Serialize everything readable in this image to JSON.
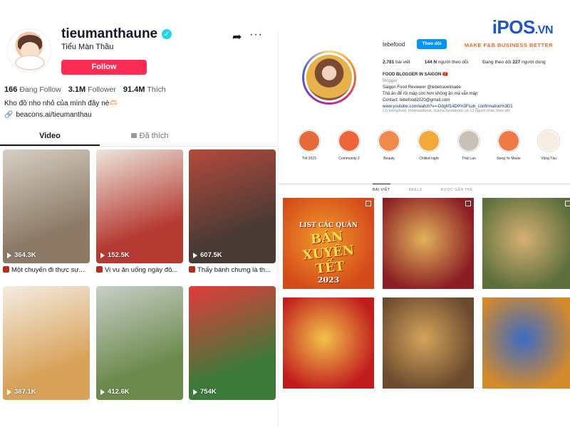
{
  "watermark": {
    "brand": "iPOS",
    "suffix": ".VN",
    "tagline": "MAKE F&B BUSINESS BETTER"
  },
  "tiktok": {
    "username": "tieumanthaune",
    "nickname": "Tiểu Màn Thầu",
    "follow_label": "Follow",
    "stats": {
      "following_count": "166",
      "following_label": "Đang Follow",
      "followers_count": "3.1M",
      "followers_label": "Follower",
      "likes_count": "91.4M",
      "likes_label": "Thích"
    },
    "bio": "Kho đồ nho nhỏ của mình đây nè🫶🏻",
    "link": "beacons.ai/tieumanthau",
    "tabs": [
      {
        "label": "Video"
      },
      {
        "label": "Đã thích"
      }
    ],
    "videos": [
      {
        "views": "364.3K",
        "caption": "Một chuyến đi thực sự...",
        "colors": [
          "#8c7a66",
          "#d7cfc4"
        ]
      },
      {
        "views": "152.5K",
        "caption": "Vi vu ăn uống ngày đô...",
        "colors": [
          "#b53a32",
          "#ece6dc"
        ]
      },
      {
        "views": "607.5K",
        "caption": "Thấy bánh chưng là th...",
        "colors": [
          "#4a3a34",
          "#b44a3c"
        ]
      },
      {
        "views": "387.1K",
        "caption": "",
        "colors": [
          "#d9a25a",
          "#f3ede2"
        ]
      },
      {
        "views": "412.6K",
        "caption": "",
        "colors": [
          "#6c8a4c",
          "#c8cec8"
        ]
      },
      {
        "views": "754K",
        "caption": "",
        "colors": [
          "#3d7a3a",
          "#e23b3b"
        ]
      }
    ]
  },
  "instagram": {
    "username": "tebefood",
    "follow_label": "Theo dõi",
    "stats": {
      "posts_count": "2.781",
      "posts_label": "bài viết",
      "followers_count": "144 N",
      "followers_label": "người theo dõi",
      "following_prefix": "Đang theo dõi",
      "following_count": "227",
      "following_label": "người dùng"
    },
    "bio": {
      "line1": "FOOD BLOGGER IN SAIGON 🇻🇳",
      "line2": "Blogger",
      "line3": "Saigon Food Reviewer @tebetravelmade",
      "line4": "Thả ăn để rồi mập còn hơn không ăn mà vẫn mập",
      "line5": "Contact: tebefood2020@gmail.com",
      "line6": "www.youtube.com/watch?v=-Ddghf14D0%3Fsub_confirmation%3D1"
    },
    "followed_by": "Có fuongfood, linhmeatbook, hukha.foodaholic và 12 người khác theo dõi",
    "highlights": [
      {
        "label": "Tết 2023",
        "color": "#e86a3c"
      },
      {
        "label": "Community 2",
        "color": "#f0643b"
      },
      {
        "label": "Beauty",
        "color": "#f08a4a"
      },
      {
        "label": "Chilled night",
        "color": "#f2a93a"
      },
      {
        "label": "Thái Lan",
        "color": "#c9c1b5"
      },
      {
        "label": "Song Ye Movie",
        "color": "#ef7a45"
      },
      {
        "label": "Vũng Tàu",
        "color": "#f6ece0"
      }
    ],
    "tabs": [
      {
        "label": "BÀI VIẾT"
      },
      {
        "label": "REELS"
      },
      {
        "label": "ĐƯỢC GẮN THẺ"
      }
    ],
    "posts": [
      {
        "colors": [
          "#d44a1a",
          "#f29b2c"
        ],
        "overlay_l1": "LIST CÁC QUÁN",
        "overlay_l2": "BÁN XUYÊN TẾT",
        "overlay_l3": "2023"
      },
      {
        "colors": [
          "#8b1d24",
          "#e2b25a"
        ]
      },
      {
        "colors": [
          "#5b6e3c",
          "#d6b072"
        ]
      },
      {
        "colors": [
          "#c21d1d",
          "#f2c24a"
        ]
      },
      {
        "colors": [
          "#6b4a2e",
          "#d4a35c"
        ]
      },
      {
        "colors": [
          "#d58a2a",
          "#3b6cc4"
        ]
      }
    ]
  }
}
